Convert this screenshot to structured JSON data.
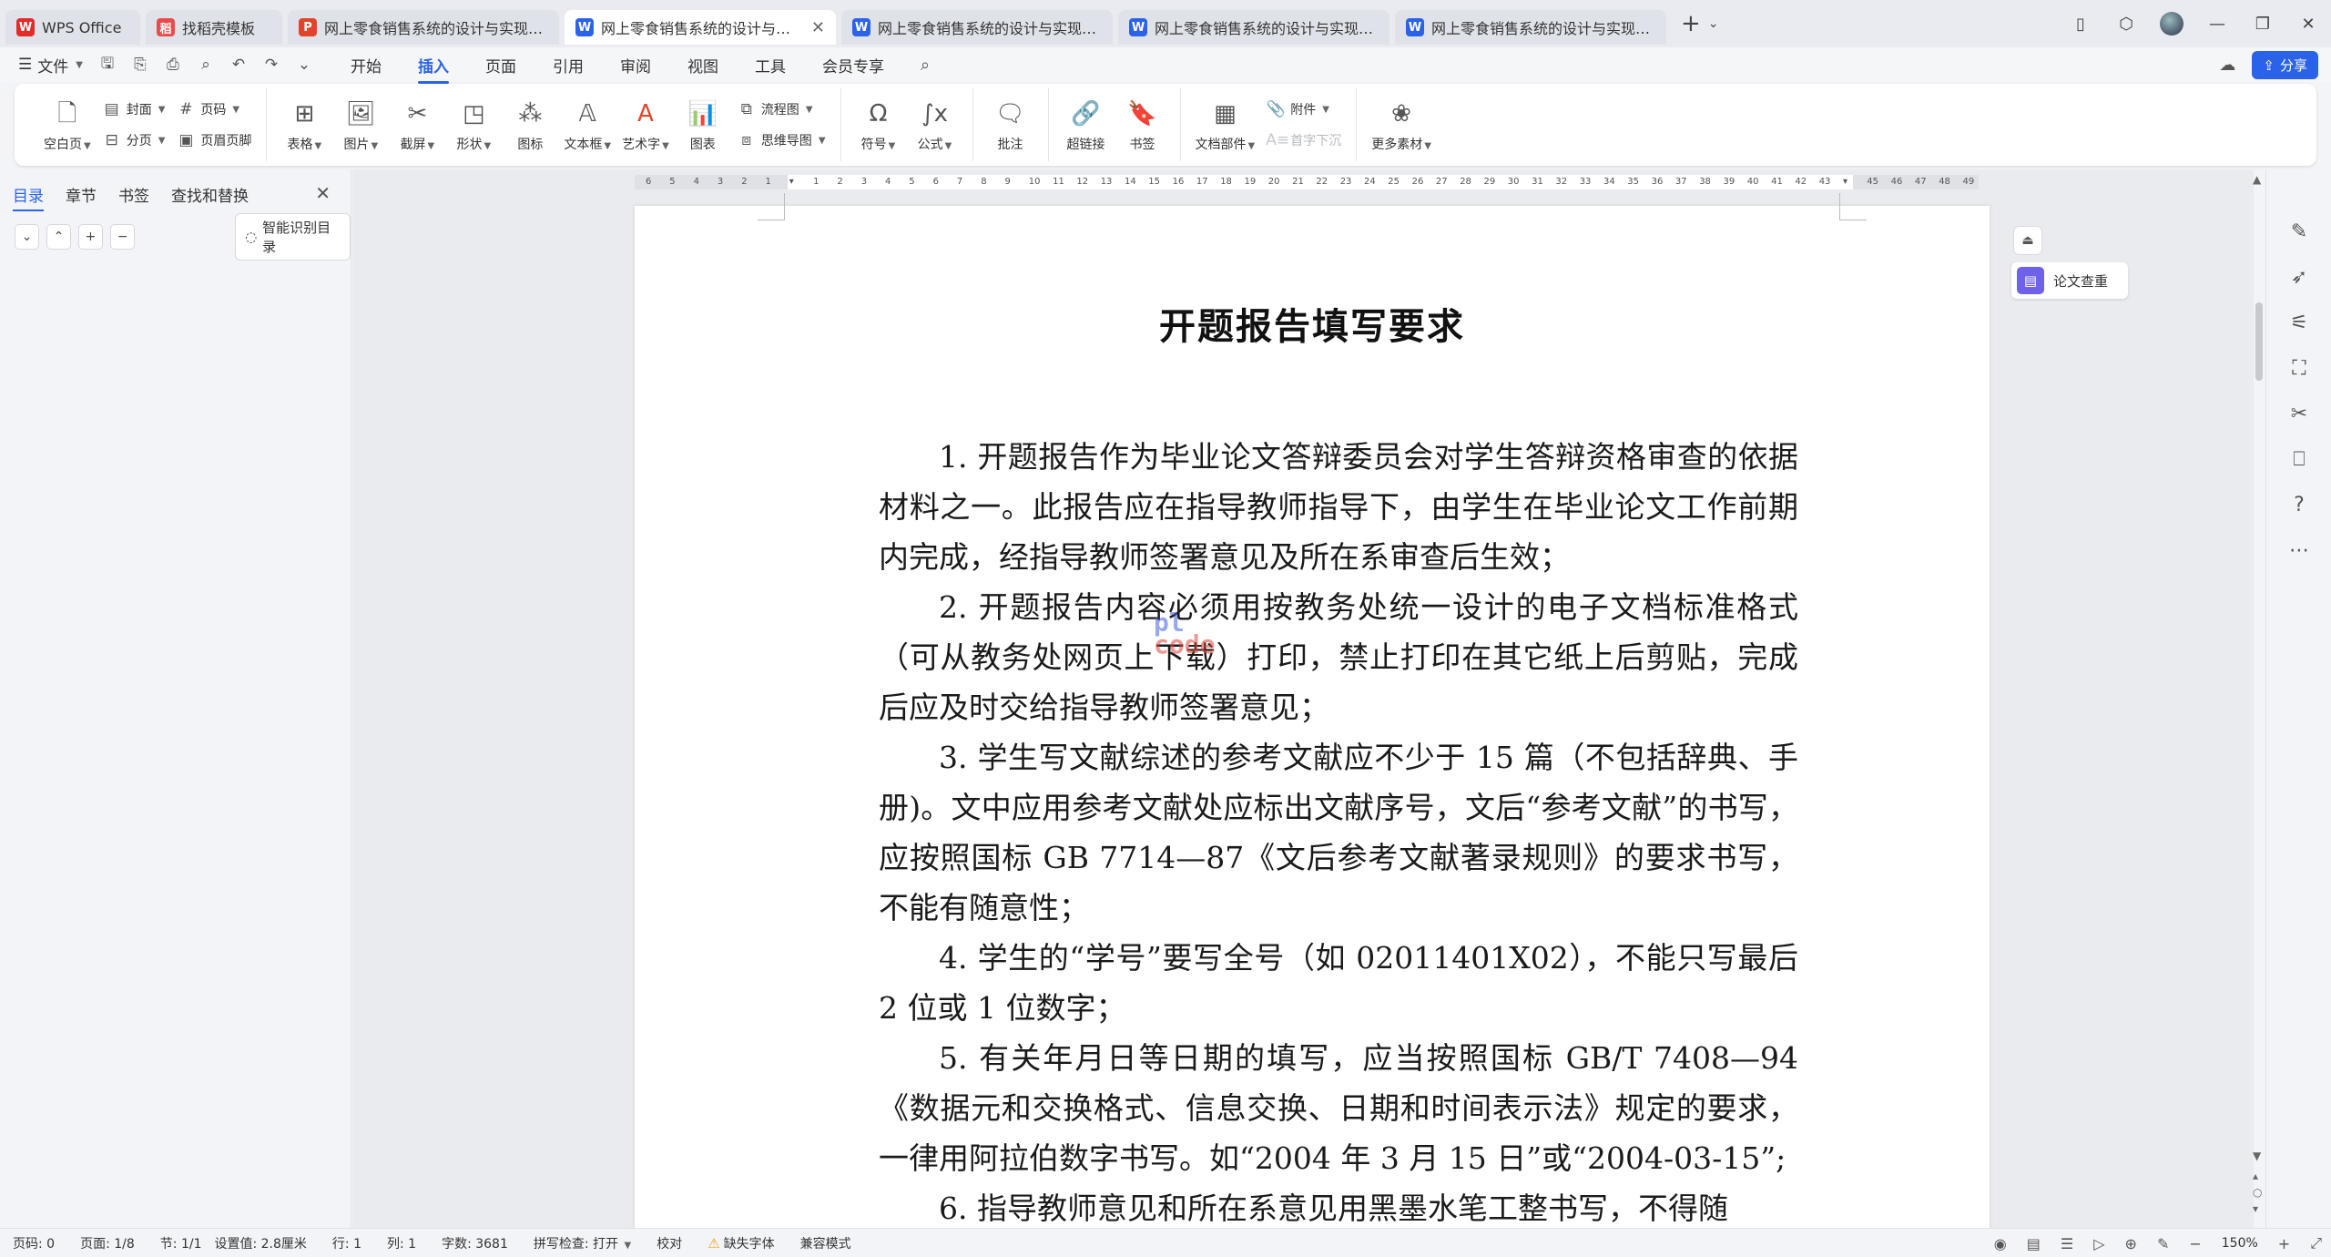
{
  "tabs": [
    {
      "label": "WPS Office",
      "icon": "wps-logo-icon",
      "type": "wps"
    },
    {
      "label": "找稻壳模板",
      "icon": "docer-icon",
      "type": "tpl"
    },
    {
      "label": "网上零食销售系统的设计与实现毕业",
      "icon": "ppt-file-icon",
      "type": "p"
    },
    {
      "label": "网上零食销售系统的设计与实现毕业",
      "icon": "word-file-icon",
      "type": "w",
      "active": true
    },
    {
      "label": "网上零食销售系统的设计与实现毕业",
      "icon": "word-file-icon",
      "type": "w"
    },
    {
      "label": "网上零食销售系统的设计与实现毕业",
      "icon": "word-file-icon",
      "type": "w"
    },
    {
      "label": "网上零食销售系统的设计与实现毕业",
      "icon": "word-file-icon",
      "type": "w"
    }
  ],
  "menu": {
    "file": "文件",
    "tabs": [
      "开始",
      "插入",
      "页面",
      "引用",
      "审阅",
      "视图",
      "工具",
      "会员专享"
    ],
    "active_tab": "插入",
    "share": "分享"
  },
  "ribbon": {
    "blank_page": "空白页",
    "cover": "封面",
    "page_break": "分页",
    "page_number": "页码",
    "header_footer": "页眉页脚",
    "table": "表格",
    "picture": "图片",
    "screenshot": "截屏",
    "shape": "形状",
    "icons": "图标",
    "textbox": "文本框",
    "wordart": "艺术字",
    "chart": "图表",
    "flowchart": "流程图",
    "mindmap": "思维导图",
    "symbol": "符号",
    "formula": "公式",
    "comment": "批注",
    "hyperlink": "超链接",
    "bookmark": "书签",
    "doc_parts": "文档部件",
    "attachment": "附件",
    "drop_cap": "首字下沉",
    "more_materials": "更多素材"
  },
  "nav": {
    "tabs": [
      "目录",
      "章节",
      "书签",
      "查找和替换"
    ],
    "active": "目录",
    "smart_toc": "智能识别目录"
  },
  "document": {
    "title": "开题报告填写要求",
    "paragraphs": [
      "1. 开题报告作为毕业论文答辩委员会对学生答辩资格审查的依据材料之一。此报告应在指导教师指导下，由学生在毕业论文工作前期内完成，经指导教师签署意见及所在系审查后生效；",
      "2. 开题报告内容必须用按教务处统一设计的电子文档标准格式（可从教务处网页上下载）打印，禁止打印在其它纸上后剪贴，完成后应及时交给指导教师签署意见；",
      "3. 学生写文献综述的参考文献应不少于 15 篇（不包括辞典、手册)。文中应用参考文献处应标出文献序号，文后“参考文献”的书写，应按照国标 GB 7714—87《文后参考文献著录规则》的要求书写，不能有随意性；",
      "4. 学生的“学号”要写全号（如 02011401X02），不能只写最后 2 位或 1 位数字；",
      "5. 有关年月日等日期的填写，应当按照国标 GB/T 7408—94《数据元和交换格式、信息交换、日期和时间表示法》规定的要求，一律用阿拉伯数字书写。如“2004 年 3 月 15 日”或“2004-03-15”;",
      "6. 指导教师意见和所在系意见用黑墨水笔工整书写，不得随"
    ],
    "watermark_line1": "pl",
    "watermark_line2": "code"
  },
  "ruler_ticks": [
    "6",
    "5",
    "4",
    "3",
    "2",
    "1",
    "",
    "1",
    "2",
    "3",
    "4",
    "5",
    "6",
    "7",
    "8",
    "9",
    "10",
    "11",
    "12",
    "13",
    "14",
    "15",
    "16",
    "17",
    "18",
    "19",
    "20",
    "21",
    "22",
    "23",
    "24",
    "25",
    "26",
    "27",
    "28",
    "29",
    "30",
    "31",
    "32",
    "33",
    "34",
    "35",
    "36",
    "37",
    "38",
    "39",
    "40",
    "41",
    "42",
    "43",
    "",
    "45",
    "46",
    "47",
    "48",
    "49"
  ],
  "side": {
    "paper_check": "论文查重"
  },
  "status": {
    "page_num": "页码: 0",
    "pages": "页面: 1/8",
    "section": "节: 1/1",
    "setting": "设置值: 2.8厘米",
    "row": "行: 1",
    "col": "列: 1",
    "word_count": "字数: 3681",
    "spell_check": "拼写检查: 打开",
    "proofread": "校对",
    "missing_font": "缺失字体",
    "compat_mode": "兼容模式",
    "zoom": "150%"
  },
  "colors": {
    "accent": "#2b63e8",
    "paper_check": "#6d62e8",
    "warning": "#f2a31b"
  }
}
